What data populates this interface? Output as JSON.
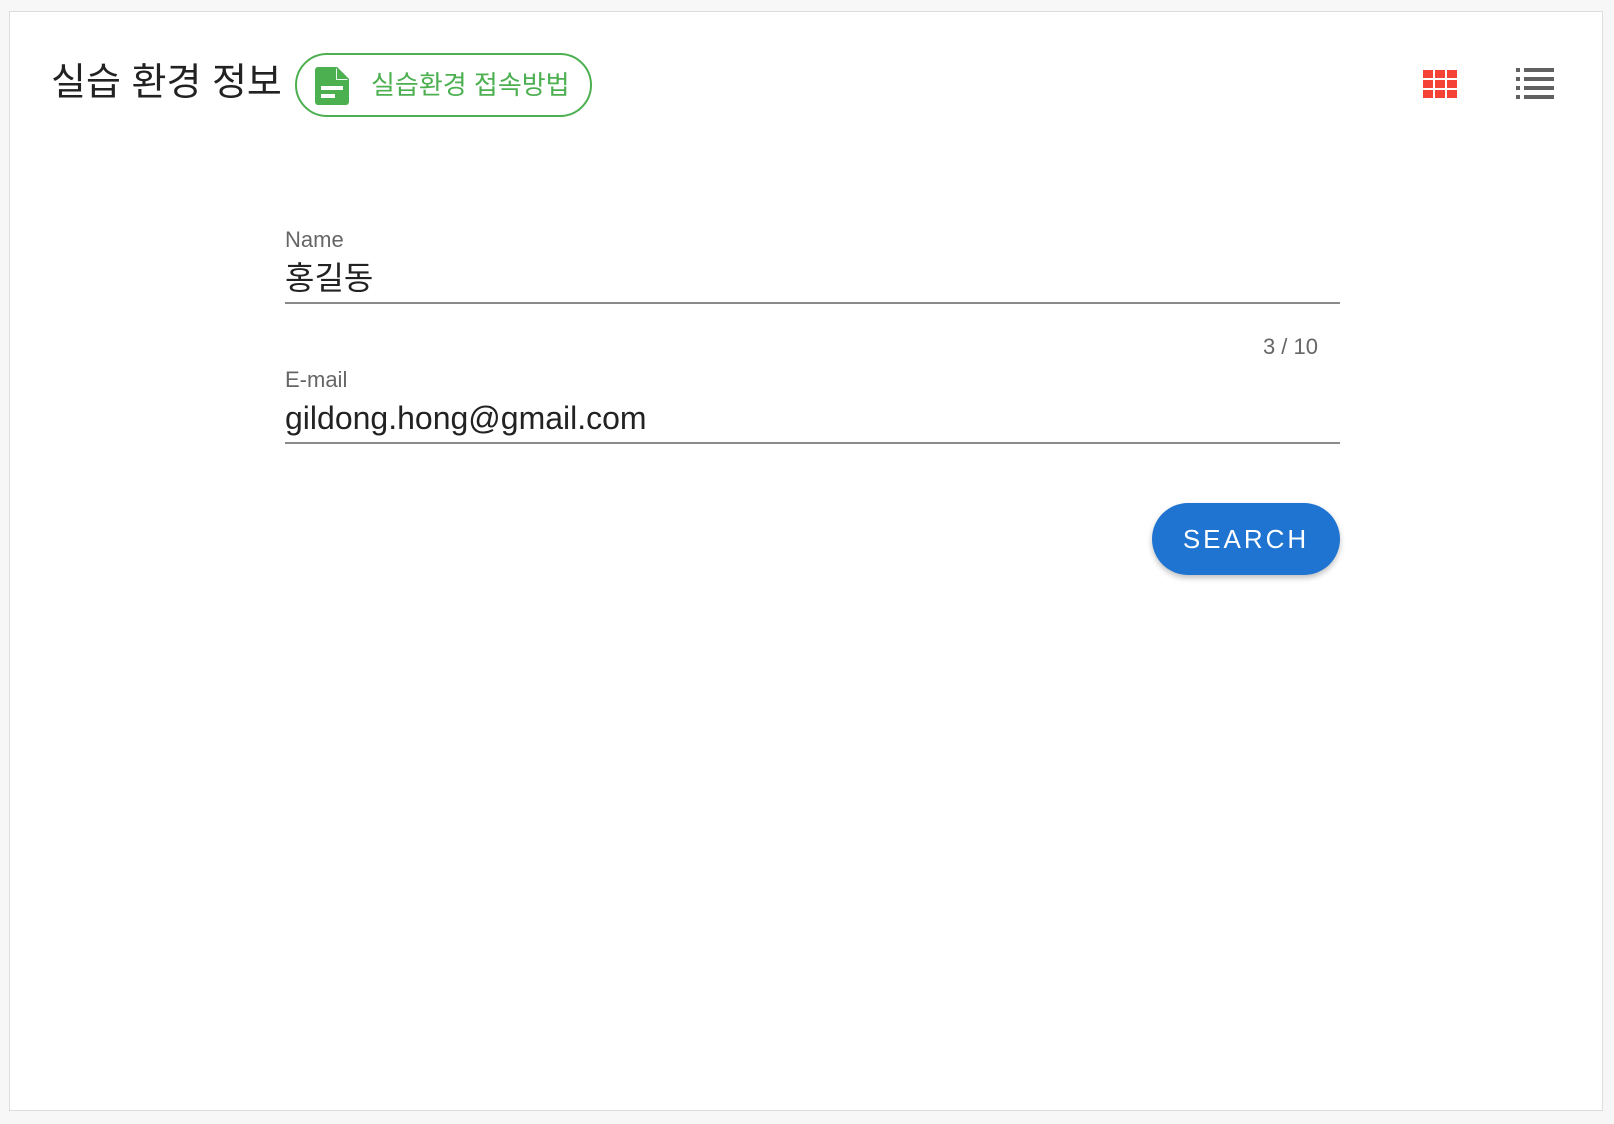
{
  "header": {
    "title": "실습 환경 정보",
    "guide_chip": {
      "label": "실습환경 접속방법",
      "icon": "document-icon",
      "color": "#4caf50"
    },
    "view_toggle": {
      "grid_icon": "grid-view-icon",
      "grid_color": "#f44336",
      "list_icon": "list-view-icon",
      "list_color": "#616161"
    }
  },
  "form": {
    "name": {
      "label": "Name",
      "value": "홍길동",
      "counter": "3 / 10"
    },
    "email": {
      "label": "E-mail",
      "value": "gildong.hong@gmail.com"
    },
    "search_button": {
      "label": "SEARCH",
      "color": "#1f74d2"
    }
  }
}
